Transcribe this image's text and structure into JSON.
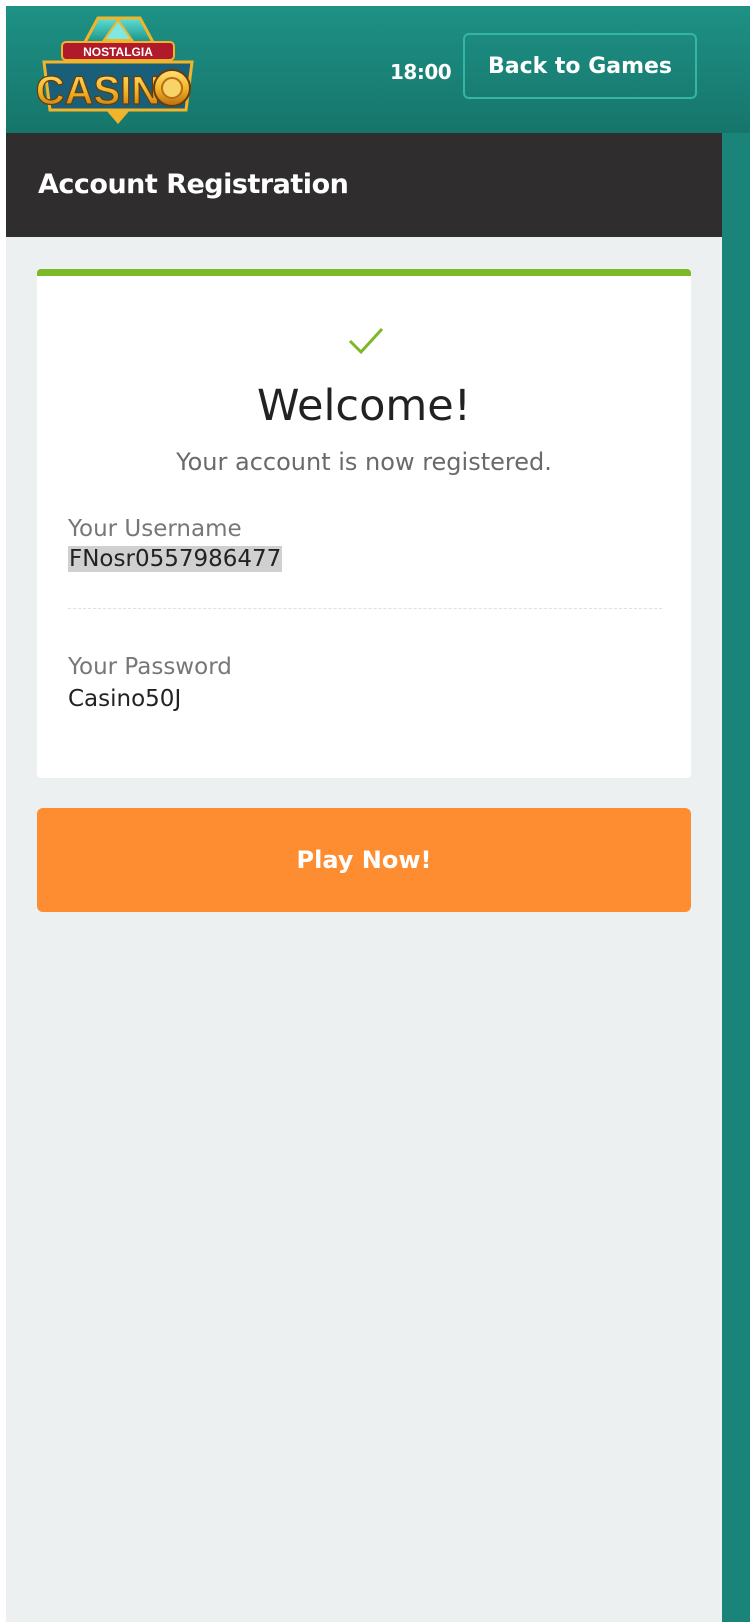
{
  "header": {
    "logo_text_top": "NOSTALGIA",
    "logo_text_main": "CASIN",
    "time": "18:00",
    "back_label": "Back to Games"
  },
  "page": {
    "title": "Account Registration"
  },
  "card": {
    "heading": "Welcome!",
    "subtitle": "Your account is now registered.",
    "username_label": "Your Username",
    "username_value": "FNosr0557986477",
    "password_label": "Your Password",
    "password_value": "Casino50J"
  },
  "actions": {
    "play_label": "Play Now!"
  },
  "colors": {
    "header_teal": "#1b8479",
    "titlebar": "#2f2d2e",
    "accent_green": "#7db827",
    "play_orange": "#fd8d30",
    "background": "#ecf0f1"
  },
  "icons": {
    "success": "checkmark-icon"
  }
}
